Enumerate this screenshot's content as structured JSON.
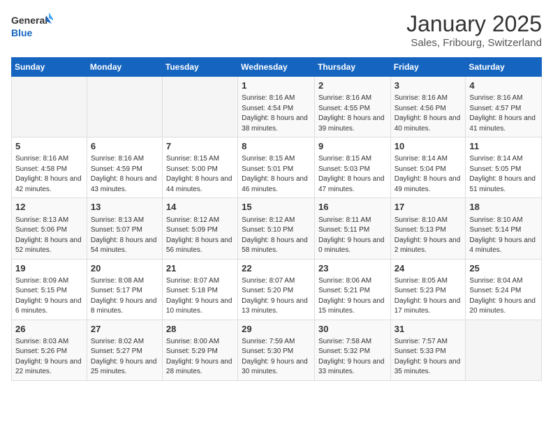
{
  "header": {
    "logo_general": "General",
    "logo_blue": "Blue",
    "month_year": "January 2025",
    "location": "Sales, Fribourg, Switzerland"
  },
  "weekdays": [
    "Sunday",
    "Monday",
    "Tuesday",
    "Wednesday",
    "Thursday",
    "Friday",
    "Saturday"
  ],
  "weeks": [
    [
      {
        "day": "",
        "sunrise": "",
        "sunset": "",
        "daylight": ""
      },
      {
        "day": "",
        "sunrise": "",
        "sunset": "",
        "daylight": ""
      },
      {
        "day": "",
        "sunrise": "",
        "sunset": "",
        "daylight": ""
      },
      {
        "day": "1",
        "sunrise": "Sunrise: 8:16 AM",
        "sunset": "Sunset: 4:54 PM",
        "daylight": "Daylight: 8 hours and 38 minutes."
      },
      {
        "day": "2",
        "sunrise": "Sunrise: 8:16 AM",
        "sunset": "Sunset: 4:55 PM",
        "daylight": "Daylight: 8 hours and 39 minutes."
      },
      {
        "day": "3",
        "sunrise": "Sunrise: 8:16 AM",
        "sunset": "Sunset: 4:56 PM",
        "daylight": "Daylight: 8 hours and 40 minutes."
      },
      {
        "day": "4",
        "sunrise": "Sunrise: 8:16 AM",
        "sunset": "Sunset: 4:57 PM",
        "daylight": "Daylight: 8 hours and 41 minutes."
      }
    ],
    [
      {
        "day": "5",
        "sunrise": "Sunrise: 8:16 AM",
        "sunset": "Sunset: 4:58 PM",
        "daylight": "Daylight: 8 hours and 42 minutes."
      },
      {
        "day": "6",
        "sunrise": "Sunrise: 8:16 AM",
        "sunset": "Sunset: 4:59 PM",
        "daylight": "Daylight: 8 hours and 43 minutes."
      },
      {
        "day": "7",
        "sunrise": "Sunrise: 8:15 AM",
        "sunset": "Sunset: 5:00 PM",
        "daylight": "Daylight: 8 hours and 44 minutes."
      },
      {
        "day": "8",
        "sunrise": "Sunrise: 8:15 AM",
        "sunset": "Sunset: 5:01 PM",
        "daylight": "Daylight: 8 hours and 46 minutes."
      },
      {
        "day": "9",
        "sunrise": "Sunrise: 8:15 AM",
        "sunset": "Sunset: 5:03 PM",
        "daylight": "Daylight: 8 hours and 47 minutes."
      },
      {
        "day": "10",
        "sunrise": "Sunrise: 8:14 AM",
        "sunset": "Sunset: 5:04 PM",
        "daylight": "Daylight: 8 hours and 49 minutes."
      },
      {
        "day": "11",
        "sunrise": "Sunrise: 8:14 AM",
        "sunset": "Sunset: 5:05 PM",
        "daylight": "Daylight: 8 hours and 51 minutes."
      }
    ],
    [
      {
        "day": "12",
        "sunrise": "Sunrise: 8:13 AM",
        "sunset": "Sunset: 5:06 PM",
        "daylight": "Daylight: 8 hours and 52 minutes."
      },
      {
        "day": "13",
        "sunrise": "Sunrise: 8:13 AM",
        "sunset": "Sunset: 5:07 PM",
        "daylight": "Daylight: 8 hours and 54 minutes."
      },
      {
        "day": "14",
        "sunrise": "Sunrise: 8:12 AM",
        "sunset": "Sunset: 5:09 PM",
        "daylight": "Daylight: 8 hours and 56 minutes."
      },
      {
        "day": "15",
        "sunrise": "Sunrise: 8:12 AM",
        "sunset": "Sunset: 5:10 PM",
        "daylight": "Daylight: 8 hours and 58 minutes."
      },
      {
        "day": "16",
        "sunrise": "Sunrise: 8:11 AM",
        "sunset": "Sunset: 5:11 PM",
        "daylight": "Daylight: 9 hours and 0 minutes."
      },
      {
        "day": "17",
        "sunrise": "Sunrise: 8:10 AM",
        "sunset": "Sunset: 5:13 PM",
        "daylight": "Daylight: 9 hours and 2 minutes."
      },
      {
        "day": "18",
        "sunrise": "Sunrise: 8:10 AM",
        "sunset": "Sunset: 5:14 PM",
        "daylight": "Daylight: 9 hours and 4 minutes."
      }
    ],
    [
      {
        "day": "19",
        "sunrise": "Sunrise: 8:09 AM",
        "sunset": "Sunset: 5:15 PM",
        "daylight": "Daylight: 9 hours and 6 minutes."
      },
      {
        "day": "20",
        "sunrise": "Sunrise: 8:08 AM",
        "sunset": "Sunset: 5:17 PM",
        "daylight": "Daylight: 9 hours and 8 minutes."
      },
      {
        "day": "21",
        "sunrise": "Sunrise: 8:07 AM",
        "sunset": "Sunset: 5:18 PM",
        "daylight": "Daylight: 9 hours and 10 minutes."
      },
      {
        "day": "22",
        "sunrise": "Sunrise: 8:07 AM",
        "sunset": "Sunset: 5:20 PM",
        "daylight": "Daylight: 9 hours and 13 minutes."
      },
      {
        "day": "23",
        "sunrise": "Sunrise: 8:06 AM",
        "sunset": "Sunset: 5:21 PM",
        "daylight": "Daylight: 9 hours and 15 minutes."
      },
      {
        "day": "24",
        "sunrise": "Sunrise: 8:05 AM",
        "sunset": "Sunset: 5:23 PM",
        "daylight": "Daylight: 9 hours and 17 minutes."
      },
      {
        "day": "25",
        "sunrise": "Sunrise: 8:04 AM",
        "sunset": "Sunset: 5:24 PM",
        "daylight": "Daylight: 9 hours and 20 minutes."
      }
    ],
    [
      {
        "day": "26",
        "sunrise": "Sunrise: 8:03 AM",
        "sunset": "Sunset: 5:26 PM",
        "daylight": "Daylight: 9 hours and 22 minutes."
      },
      {
        "day": "27",
        "sunrise": "Sunrise: 8:02 AM",
        "sunset": "Sunset: 5:27 PM",
        "daylight": "Daylight: 9 hours and 25 minutes."
      },
      {
        "day": "28",
        "sunrise": "Sunrise: 8:00 AM",
        "sunset": "Sunset: 5:29 PM",
        "daylight": "Daylight: 9 hours and 28 minutes."
      },
      {
        "day": "29",
        "sunrise": "Sunrise: 7:59 AM",
        "sunset": "Sunset: 5:30 PM",
        "daylight": "Daylight: 9 hours and 30 minutes."
      },
      {
        "day": "30",
        "sunrise": "Sunrise: 7:58 AM",
        "sunset": "Sunset: 5:32 PM",
        "daylight": "Daylight: 9 hours and 33 minutes."
      },
      {
        "day": "31",
        "sunrise": "Sunrise: 7:57 AM",
        "sunset": "Sunset: 5:33 PM",
        "daylight": "Daylight: 9 hours and 35 minutes."
      },
      {
        "day": "",
        "sunrise": "",
        "sunset": "",
        "daylight": ""
      }
    ]
  ]
}
